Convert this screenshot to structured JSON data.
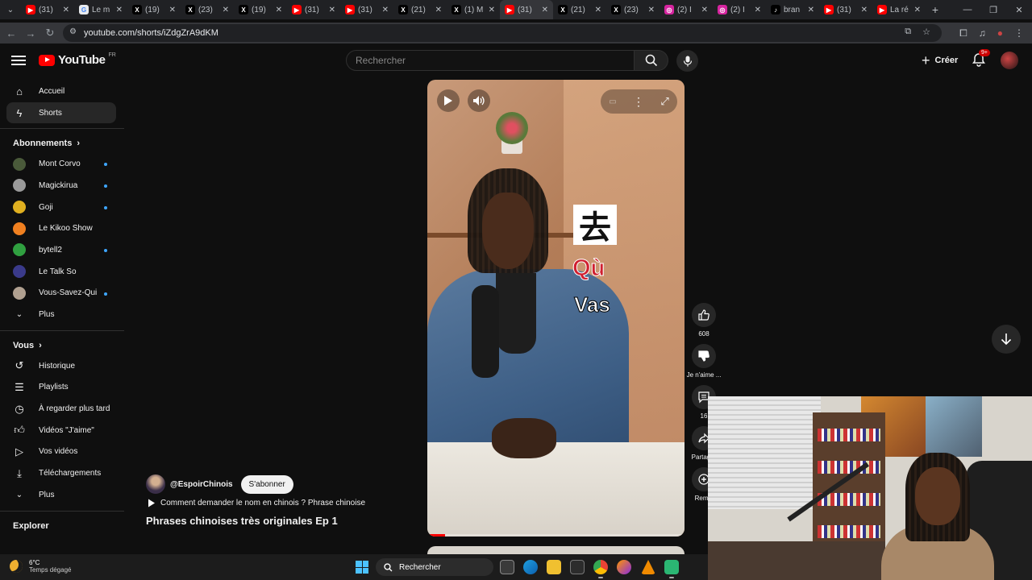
{
  "browser": {
    "tabs": [
      {
        "label": "(31)",
        "icon": "youtube-icon",
        "color": "#ff0000"
      },
      {
        "label": "Le m",
        "icon": "google-icon",
        "color": "#e8eaed"
      },
      {
        "label": "(19)",
        "icon": "x-icon",
        "color": "#000000"
      },
      {
        "label": "(23)",
        "icon": "x-icon",
        "color": "#000000"
      },
      {
        "label": "(19)",
        "icon": "x-icon",
        "color": "#000000"
      },
      {
        "label": "(31)",
        "icon": "youtube-icon",
        "color": "#ff0000"
      },
      {
        "label": "(31)",
        "icon": "youtube-icon",
        "color": "#ff0000"
      },
      {
        "label": "(21)",
        "icon": "x-icon",
        "color": "#000000"
      },
      {
        "label": "(1) M",
        "icon": "x-icon",
        "color": "#000000"
      },
      {
        "label": "(31)",
        "icon": "youtube-icon",
        "color": "#ff0000",
        "active": true
      },
      {
        "label": "(21)",
        "icon": "x-icon",
        "color": "#000000"
      },
      {
        "label": "(23)",
        "icon": "x-icon",
        "color": "#000000"
      },
      {
        "label": "(2) I",
        "icon": "instagram-icon",
        "color": "#d6249f"
      },
      {
        "label": "(2) I",
        "icon": "instagram-icon",
        "color": "#d6249f"
      },
      {
        "label": "bran",
        "icon": "tiktok-icon",
        "color": "#000000"
      },
      {
        "label": "(31)",
        "icon": "youtube-icon",
        "color": "#ff0000"
      },
      {
        "label": "La ré",
        "icon": "youtube-icon",
        "color": "#ff0000"
      }
    ],
    "url": "youtube.com/shorts/iZdgZrA9dKM"
  },
  "header": {
    "logo_text": "YouTube",
    "country_code": "FR",
    "search_placeholder": "Rechercher",
    "create_label": "Créer",
    "notif_badge": "9+"
  },
  "sidebar": {
    "main": [
      {
        "label": "Accueil",
        "icon": "home-icon"
      },
      {
        "label": "Shorts",
        "icon": "shorts-icon",
        "active": true
      }
    ],
    "subs_title": "Abonnements",
    "subs": [
      {
        "label": "Mont Corvo",
        "color": "#4a5a3a",
        "new": true
      },
      {
        "label": "Magickirua",
        "color": "#9a9a9a",
        "new": true
      },
      {
        "label": "Goji",
        "color": "#e0b020",
        "new": true
      },
      {
        "label": "Le Kikoo Show",
        "color": "#f08020",
        "new": false
      },
      {
        "label": "bytell2",
        "color": "#30a040",
        "new": true
      },
      {
        "label": "Le Talk So",
        "color": "#3a3a8a",
        "new": false
      },
      {
        "label": "Vous-Savez-Qui",
        "color": "#b0a090",
        "new": true
      }
    ],
    "subs_more": "Plus",
    "you_title": "Vous",
    "you": [
      {
        "label": "Historique",
        "icon": "history-icon"
      },
      {
        "label": "Playlists",
        "icon": "playlists-icon"
      },
      {
        "label": "À regarder plus tard",
        "icon": "watch-later-icon"
      },
      {
        "label": "Vidéos \"J'aime\"",
        "icon": "liked-icon"
      },
      {
        "label": "Vos vidéos",
        "icon": "your-videos-icon"
      },
      {
        "label": "Téléchargements",
        "icon": "downloads-icon"
      }
    ],
    "you_more": "Plus",
    "explore_title": "Explorer"
  },
  "short": {
    "overlay_char": "去",
    "overlay_pinyin": "Qù",
    "overlay_french": "Vas",
    "channel": "@EspoirChinois",
    "subscribe_label": "S'abonner",
    "sound": "Comment demander le nom en chinois ? Phrase chinoise",
    "title": "Phrases chinoises très originales Ep 1",
    "progress": 0.07
  },
  "actions": {
    "like_count": "608",
    "dislike_label": "Je n'aime ...",
    "comments_count": "16",
    "share_label": "Partager",
    "remix_label": "Remix"
  },
  "taskbar": {
    "temp": "6°C",
    "weather": "Temps dégagé",
    "search_label": "Rechercher"
  }
}
